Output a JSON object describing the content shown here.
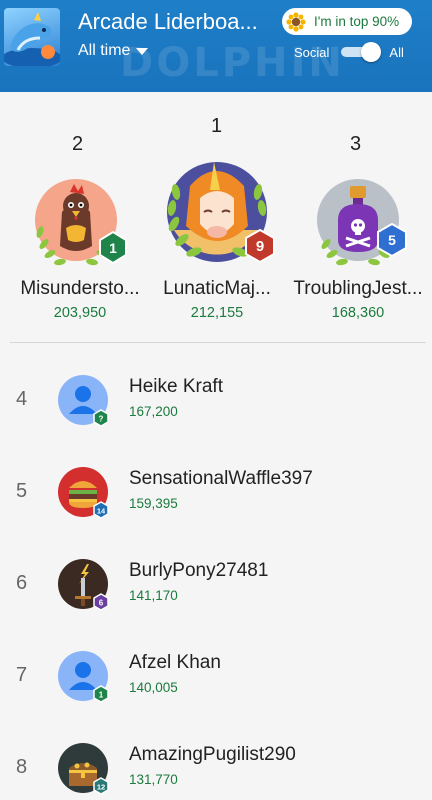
{
  "header": {
    "banner_text": "DOLPHIN",
    "title": "Arcade Liderboa...",
    "time_filter": "All time",
    "top_chip": "I'm in top 90%",
    "toggle_left": "Social",
    "toggle_right": "All",
    "toggle_state": "All"
  },
  "podium": [
    {
      "rank": "1",
      "name": "LunaticMaj...",
      "score": "212,155",
      "level": "9",
      "badge_color": "#c0392b",
      "avatar": "unicorn-icon"
    },
    {
      "rank": "2",
      "name": "Misundersto...",
      "score": "203,950",
      "level": "1",
      "badge_color": "#1e8449",
      "avatar": "rooster-icon"
    },
    {
      "rank": "3",
      "name": "TroublingJest...",
      "score": "168,360",
      "level": "5",
      "badge_color": "#2e6fd1",
      "avatar": "poison-bottle-icon"
    }
  ],
  "list": [
    {
      "rank": "4",
      "name": "Heike Kraft",
      "score": "167,200",
      "level": "?",
      "badge_color": "#1e8449",
      "avatar": "default-person-icon"
    },
    {
      "rank": "5",
      "name": "SensationalWaffle397",
      "score": "159,395",
      "level": "14",
      "badge_color": "#1f6fb5",
      "avatar": "burger-icon"
    },
    {
      "rank": "6",
      "name": "BurlyPony27481",
      "score": "141,170",
      "level": "6",
      "badge_color": "#6b3fa0",
      "avatar": "sword-icon"
    },
    {
      "rank": "7",
      "name": "Afzel Khan",
      "score": "140,005",
      "level": "1",
      "badge_color": "#1e8449",
      "avatar": "default-person-icon"
    },
    {
      "rank": "8",
      "name": "AmazingPugilist290",
      "score": "131,770",
      "level": "12",
      "badge_color": "#2b7a78",
      "avatar": "treasure-chest-icon"
    }
  ]
}
